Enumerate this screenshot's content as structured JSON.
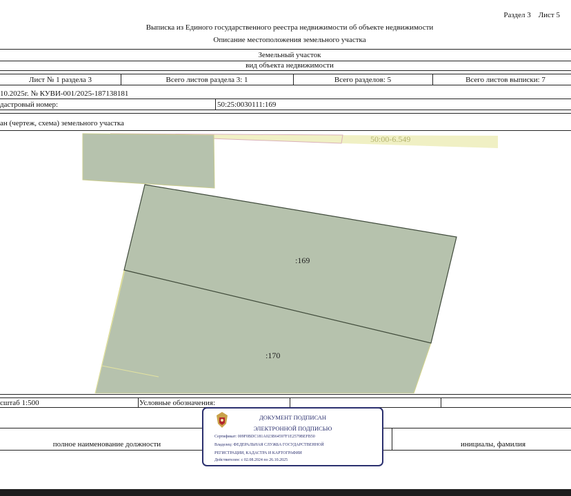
{
  "header": {
    "section": "Раздел 3",
    "sheet": "Лист 5",
    "title": "Выписка из Единого государственного реестра недвижимости об объекте недвижимости",
    "subtitle": "Описание местоположения земельного участка"
  },
  "object": {
    "name": "Земельный участок",
    "kind_label": "вид объекта недвижимости"
  },
  "sheet_row": {
    "sheet_of_section": "Лист № 1 раздела 3",
    "total_section_sheets": "Всего листов раздела 3: 1",
    "total_sections": "Всего разделов: 5",
    "total_extract_sheets": "Всего листов выписки: 7"
  },
  "extract_number": "10.2025г. № КУВИ-001/2025-187138181",
  "cadastral": {
    "label": "дастровый номер:",
    "value": "50:25:0030111:169"
  },
  "plan_label": "ан (чертеж, схема) земельного участка",
  "plan": {
    "quarter_label": "50:00-6.549",
    "parcel_main": ":169",
    "parcel_neighbor": ":170",
    "colors": {
      "parcel_fill": "#b6c2ad",
      "parcel_stroke": "#3f4a3b",
      "zone_fill": "#f0f0c4"
    }
  },
  "footer": {
    "scale": "сштаб 1:500",
    "legend_label": "Условные обозначения:",
    "position_label": "полное наименование должности",
    "initials_label": "инициалы, фамилия"
  },
  "stamp": {
    "line1": "ДОКУМЕНТ ПОДПИСАН",
    "line2": "ЭЛЕКТРОННОЙ ПОДПИСЬЮ",
    "certificate": "Сертификат: 009F0BDC181A023B64597F1E2579BEFB50",
    "owner_line1": "Владелец: ФЕДЕРАЛЬНАЯ СЛУЖБА ГОСУДАРСТВЕННОЙ",
    "owner_line2": "РЕГИСТРАЦИИ, КАДАСТРА И КАРТОГРАФИИ",
    "validity": "Действителен: с 02.08.2024 по 26.10.2025",
    "color": "#2a2f6e"
  }
}
